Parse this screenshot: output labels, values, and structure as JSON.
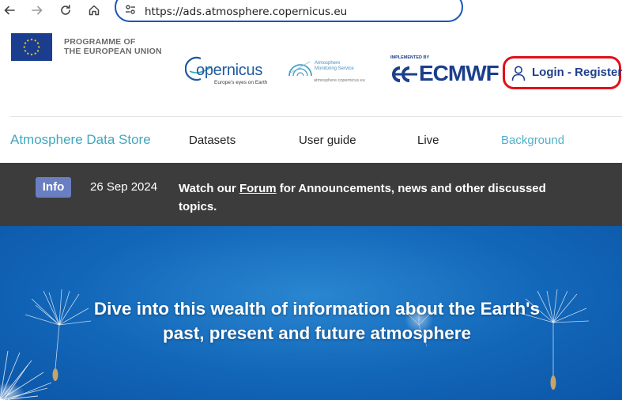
{
  "browser": {
    "url": "https://ads.atmosphere.copernicus.eu",
    "icons": [
      "back-icon",
      "forward-icon",
      "reload-icon",
      "home-icon",
      "site-info-icon"
    ]
  },
  "logos": {
    "eu": {
      "line1": "PROGRAMME OF",
      "line2": "THE EUROPEAN UNION"
    },
    "copernicus": {
      "word": "opernicus",
      "tagline": "Europe's eyes on Earth"
    },
    "cams": {
      "line1": "Atmosphere",
      "line2": "Monitoring Service",
      "url": "atmosphere.copernicus.eu"
    },
    "ecmwf": {
      "implemented_by": "IMPLEMENTED BY",
      "word": "ECMWF"
    }
  },
  "header": {
    "login_label": "Login - Register"
  },
  "nav": {
    "brand": "Atmosphere Data Store",
    "items": [
      {
        "label": "Datasets"
      },
      {
        "label": "User guide"
      },
      {
        "label": "Live"
      },
      {
        "label": "Background"
      }
    ]
  },
  "banner": {
    "badge": "Info",
    "date": "26 Sep 2024",
    "msg_prefix": "Watch our ",
    "link": "Forum",
    "msg_suffix": " for Announcements, news and other discussed topics."
  },
  "hero": {
    "line1": "Dive into this wealth of information about the Earth's",
    "line2": "past, present and future atmosphere"
  },
  "colors": {
    "brand_teal": "#3fa7be",
    "login_blue": "#1f3f8c",
    "highlight_red": "#e0101a",
    "banner_bg": "#3c3c3c",
    "badge_bg": "#6a7fc2",
    "hero_blue": "#1266b8"
  }
}
